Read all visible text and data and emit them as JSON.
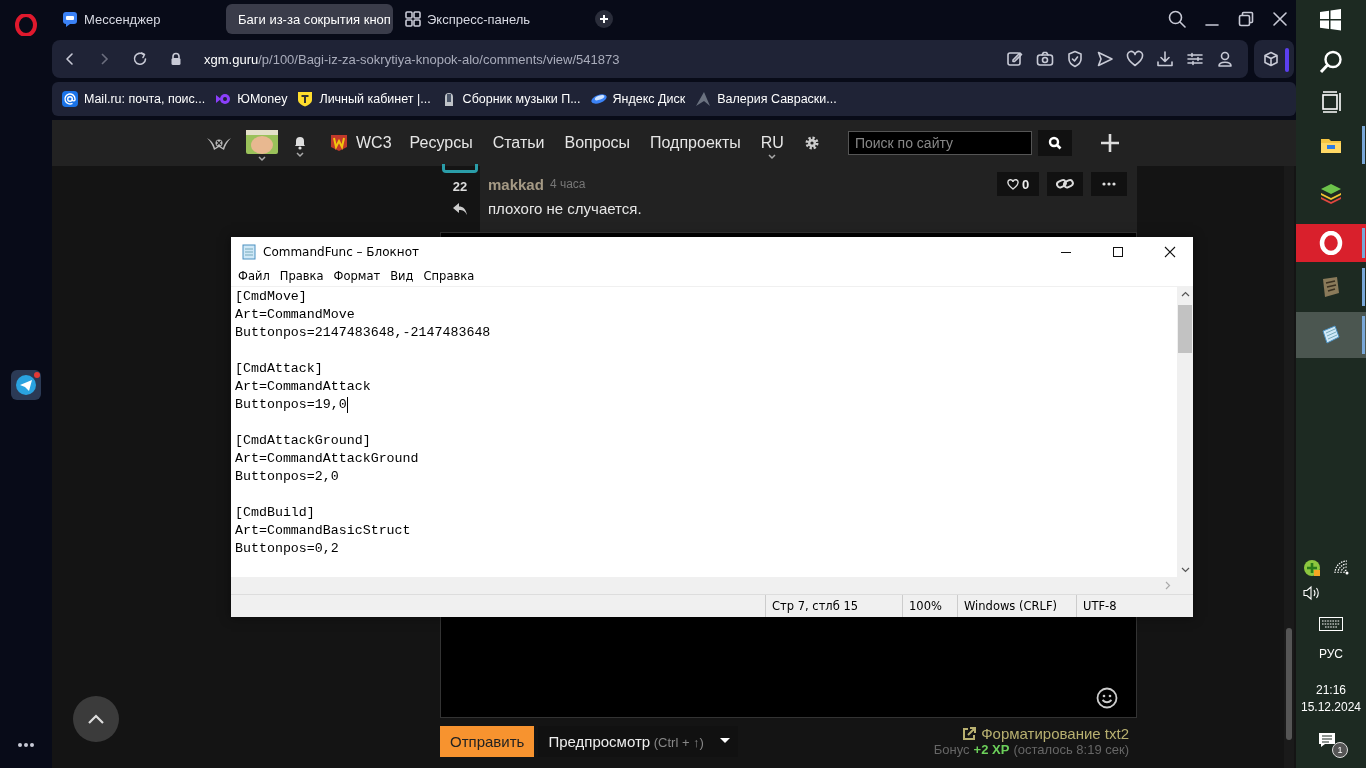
{
  "sidebar": {
    "notification_dot": true
  },
  "tabs": [
    {
      "label": "Мессенджер",
      "kind": "messenger",
      "selected": false
    },
    {
      "label": "Баги из-за сокрытия кноп",
      "kind": "site",
      "selected": true
    },
    {
      "label": "Экспресс-панель",
      "kind": "speed-dial",
      "selected": false
    }
  ],
  "address_bar": {
    "domain": "xgm.guru",
    "path": "/p/100/Bagi-iz-za-sokrytiya-knopok-alo/comments/view/541873"
  },
  "bookmarks": [
    {
      "label": "Mail.ru: почта, поис...",
      "kind": "mail"
    },
    {
      "label": "ЮMoney",
      "kind": "money"
    },
    {
      "label": "Личный кабинет |...",
      "kind": "bank"
    },
    {
      "label": "Сборник музыки П...",
      "kind": "music"
    },
    {
      "label": "Яндекс Диск",
      "kind": "disk"
    },
    {
      "label": "Валерия Савраски...",
      "kind": "peak"
    }
  ],
  "site_nav": {
    "items": [
      {
        "label": "WC3",
        "kind": "game"
      },
      {
        "label": "Ресурсы",
        "kind": "link"
      },
      {
        "label": "Статьи",
        "kind": "link"
      },
      {
        "label": "Вопросы",
        "kind": "link"
      },
      {
        "label": "Подпроекты",
        "kind": "link"
      },
      {
        "label": "RU",
        "kind": "dropdown"
      }
    ],
    "search": {
      "placeholder": "Поиск по сайту"
    }
  },
  "comment": {
    "score": "22",
    "author": "makkad",
    "time": "4 часа",
    "text": "плохого не случается.",
    "likes": "0"
  },
  "notepad": {
    "title": "CommandFunc – Блокнот",
    "menu": [
      "Файл",
      "Правка",
      "Формат",
      "Вид",
      "Справка"
    ],
    "blocks": [
      [
        {
          "text": "[CmdMove]",
          "cursor": false
        },
        {
          "text": "Art=CommandMove",
          "cursor": false
        },
        {
          "text": "Buttonpos=2147483648,-2147483648",
          "cursor": false
        }
      ],
      [
        {
          "text": "[CmdAttack]",
          "cursor": false
        },
        {
          "text": "Art=CommandAttack",
          "cursor": false
        },
        {
          "text": "Buttonpos=19,0",
          "cursor": true
        }
      ],
      [
        {
          "text": "[CmdAttackGround]",
          "cursor": false
        },
        {
          "text": "Art=CommandAttackGround",
          "cursor": false
        },
        {
          "text": "Buttonpos=2,0",
          "cursor": false
        }
      ],
      [
        {
          "text": "[CmdBuild]",
          "cursor": false
        },
        {
          "text": "Art=CommandBasicStruct",
          "cursor": false
        },
        {
          "text": "Buttonpos=0,2",
          "cursor": false
        }
      ]
    ],
    "status": [
      "Стр 7, стлб 15",
      "100%",
      "Windows (CRLF)",
      "UTF-8"
    ]
  },
  "form": {
    "send": "Отправить",
    "preview": "Предпросмотр",
    "shortcut": "(Ctrl + ↑)",
    "format_link": "Форматирование txt2",
    "bonus_label": "Бонус",
    "bonus_xp": "+2 XP",
    "bonus_rest": "(осталось 8:19 сек)"
  },
  "taskbar": {
    "apps": [
      {
        "kind": "explorer",
        "running": true,
        "active": false,
        "flashing": false
      },
      {
        "kind": "layers",
        "running": false,
        "active": false,
        "flashing": false
      },
      {
        "kind": "opera",
        "running": true,
        "active": false,
        "flashing": true
      },
      {
        "kind": "game",
        "running": true,
        "active": false,
        "flashing": false
      },
      {
        "kind": "notepad",
        "running": true,
        "active": true,
        "flashing": false
      }
    ],
    "language": "РУС",
    "time": "21:16",
    "date": "15.12.2024",
    "notifications": "1"
  }
}
